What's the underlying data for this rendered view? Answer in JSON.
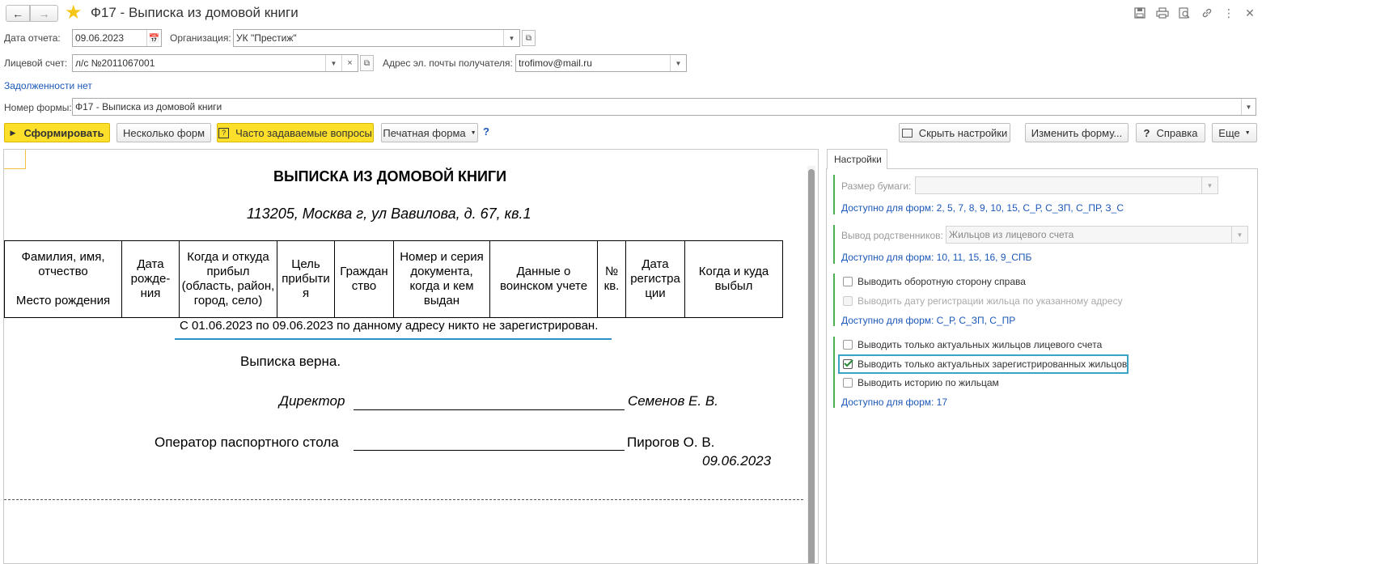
{
  "window": {
    "title": "Ф17 - Выписка из домовой книги",
    "toolbar_icons": [
      "save-icon",
      "print-icon",
      "preview-icon",
      "link-icon",
      "more-vert-icon",
      "close-icon"
    ]
  },
  "header": {
    "report_date_label": "Дата отчета:",
    "report_date_value": "09.06.2023",
    "org_label": "Организация:",
    "org_value": "УК \"Престиж\"",
    "account_label": "Лицевой счет:",
    "account_value": "л/с №2011067001",
    "email_label": "Адрес эл. почты получателя:",
    "email_value": "trofimov@mail.ru",
    "debt_link": "Задолженности нет",
    "form_number_label": "Номер формы:",
    "form_number_value": "Ф17 - Выписка из домовой книги"
  },
  "command_bar": {
    "generate": "Сформировать",
    "several_forms": "Несколько форм",
    "faq": "Часто задаваемые вопросы",
    "print_form": "Печатная форма",
    "help_q": "?",
    "hide_settings": "Скрыть настройки",
    "change_form": "Изменить форму...",
    "help": "Справка",
    "more": "Еще"
  },
  "document": {
    "title": "ВЫПИСКА ИЗ ДОМОВОЙ КНИГИ",
    "address": "113205, Москва г, ул Вавилова, д. 67, кв.1",
    "columns": [
      "Фамилия, имя, отчество\n\nМесто рождения",
      "Дата рожде-ния",
      "Когда и откуда прибыл (область, район, город, село)",
      "Цель прибыти я",
      "Граждан ство",
      "Номер и серия документа, когда и кем выдан",
      "Данные о воинском учете",
      "№ кв.",
      "Дата регистра ции",
      "Когда и куда выбыл"
    ],
    "no_registration_note": "С 01.06.2023 по 09.06.2023 по данному адресу никто не зарегистрирован.",
    "statement_correct": "Выписка верна.",
    "director_label": "Директор",
    "director_name": "Семенов Е. В.",
    "operator_label": "Оператор паспортного стола",
    "operator_name": "Пирогов О. В.",
    "sign_date": "09.06.2023"
  },
  "settings": {
    "tab": "Настройки",
    "paper_size_label": "Размер бумаги:",
    "paper_size_value": "",
    "paper_size_avail": "Доступно для форм: 2, 5, 7, 8, 9, 10, 15, С_Р, С_ЗП, С_ПР, З_С",
    "relatives_label": "Вывод родственников:",
    "relatives_value": "Жильцов из лицевого счета",
    "relatives_avail": "Доступно для форм: 10, 11, 15, 16, 9_СПБ",
    "back_side": "Выводить оборотную сторону справа",
    "reg_date": "Выводить дату регистрации жильца по указанному адресу",
    "group2_avail": "Доступно для форм: С_Р, С_ЗП, С_ПР",
    "actual_account": "Выводить только актуальных жильцов лицевого счета",
    "actual_registered": "Выводить только актуальных зарегистрированных жильцов",
    "history": "Выводить историю по жильцам",
    "group3_avail": "Доступно для форм: 17",
    "checks": {
      "back_side": false,
      "reg_date": false,
      "actual_account": false,
      "actual_registered": true,
      "history": false
    }
  }
}
